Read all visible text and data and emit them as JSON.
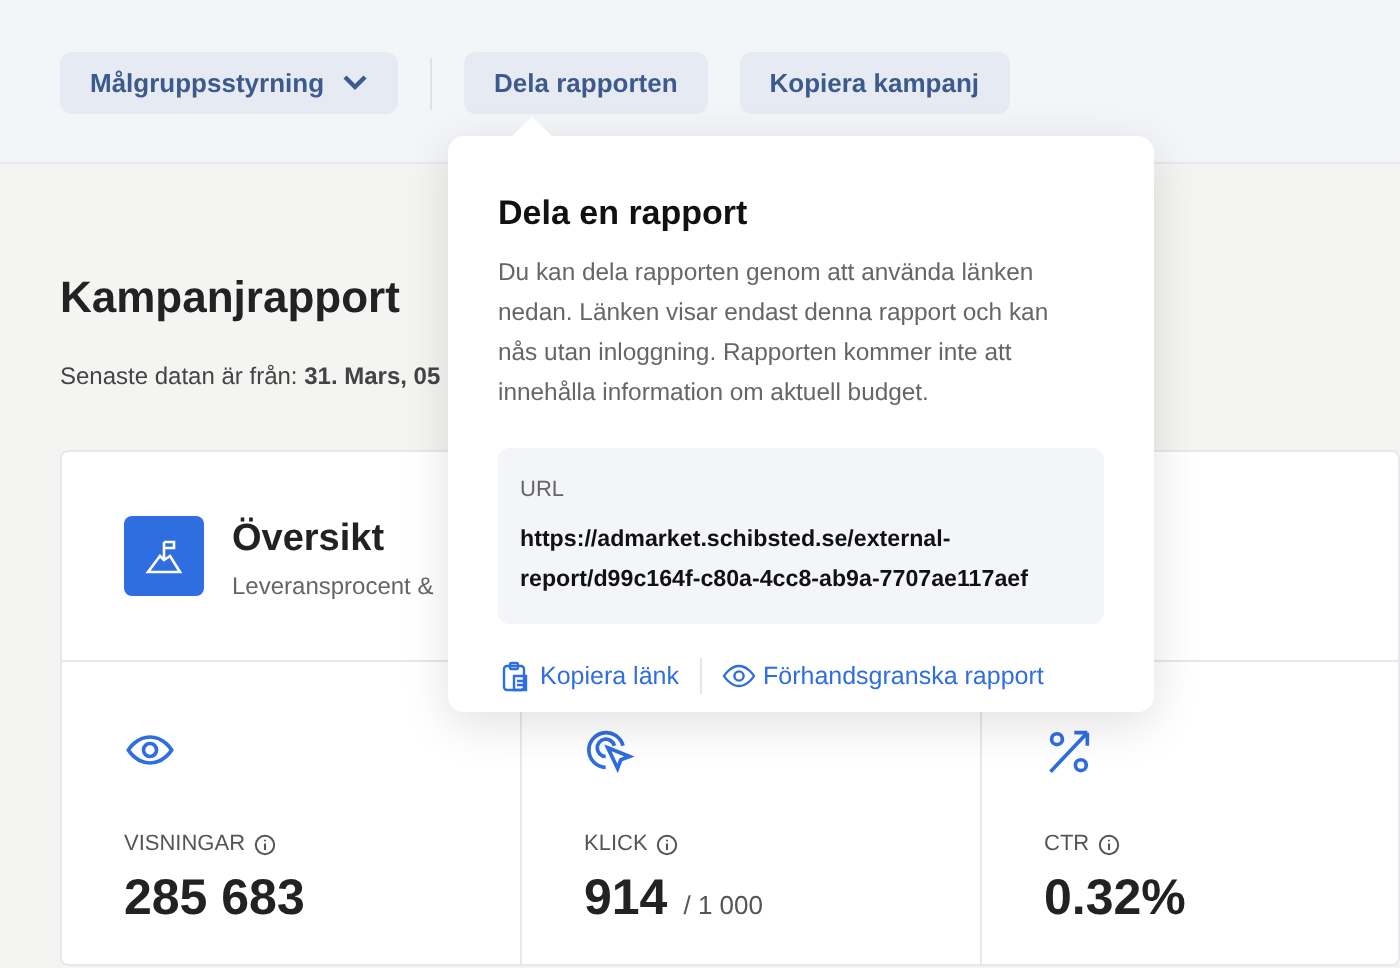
{
  "toolbar": {
    "buttons": [
      {
        "kind": "dropdown",
        "label": "Målgruppsstyrning"
      },
      {
        "kind": "plain",
        "label": "Dela rapporten"
      },
      {
        "kind": "plain",
        "label": "Kopiera kampanj"
      }
    ]
  },
  "page": {
    "title": "Kampanjrapport",
    "updated": "Senaste datan är från: **31. Mars, 05**"
  },
  "overview": {
    "title": "Översikt",
    "subtitle": "Leveransprocent &"
  },
  "stats": [
    {
      "kind": "eye",
      "label": "VISNINGAR",
      "value": "285 683"
    },
    {
      "kind": "click",
      "label": "KLICK",
      "value": "914",
      "limit": "/ 1 000"
    },
    {
      "kind": "percent",
      "label": "CTR",
      "value": "0.32%"
    }
  ],
  "share_popover": {
    "title": "Dela en rapport",
    "description": "Du kan dela rapporten genom att använda länken nedan. Länken visar endast denna rapport och kan nås utan inloggning. Rapporten kommer inte att innehålla information om aktuell budget.",
    "url_label": "URL",
    "url": "https://admarket.schibsted.se/external-report/d99c164f-c80a-4cc8-ab9a-7707ae117aef",
    "actions": [
      {
        "kind": "copy",
        "label": "Kopiera länk"
      },
      {
        "kind": "preview",
        "label": "Förhandsgranska rapport"
      }
    ]
  }
}
